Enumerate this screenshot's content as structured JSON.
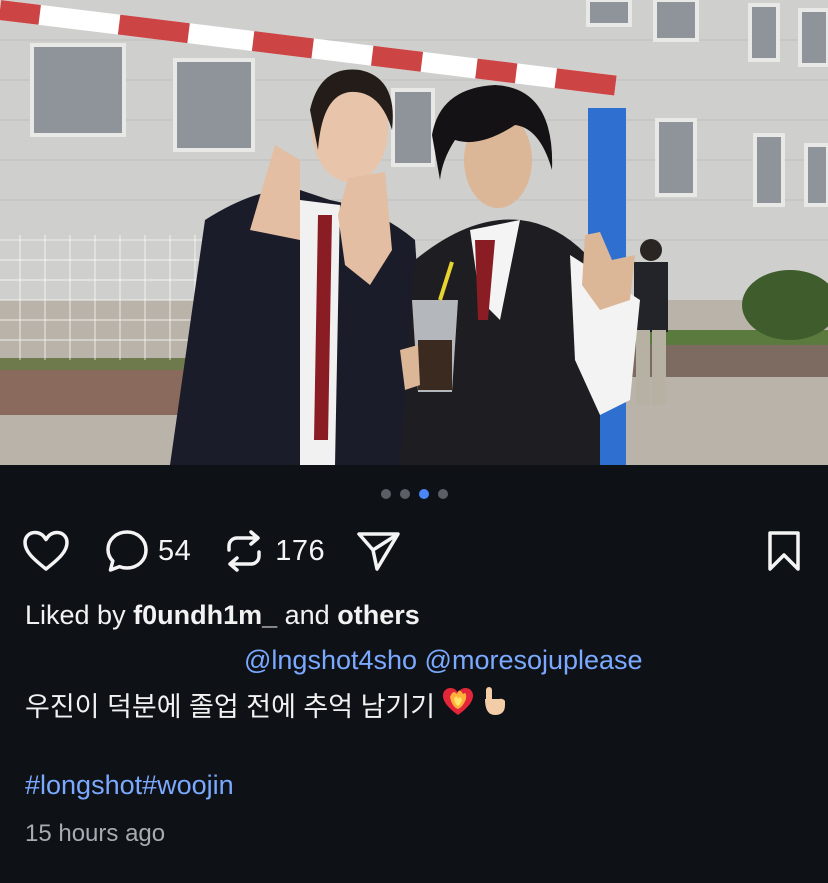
{
  "post": {
    "image": {
      "description": "photo"
    },
    "carousel": {
      "count": 4,
      "active_index": 2
    },
    "actions": {
      "like_icon": "heart-icon",
      "comment_icon": "comment-bubble-icon",
      "comment_count": "54",
      "repost_icon": "repost-icon",
      "repost_count": "176",
      "share_icon": "send-icon",
      "bookmark_icon": "bookmark-icon"
    },
    "liked_by": {
      "prefix": "Liked by",
      "user": "f0undh1m_",
      "joiner": "and",
      "others": "others"
    },
    "mentions": [
      "@lngshot4sho",
      "@moresojuplease"
    ],
    "caption": "우진이 덕분에 졸업 전에 추억 남기기",
    "caption_emojis": [
      "heart-on-fire-emoji",
      "raised-pinky-hand-emoji"
    ],
    "hashtags": [
      "#longshot",
      "#woojin"
    ],
    "timestamp": "15 hours ago"
  },
  "colors": {
    "background": "#0e1116",
    "text": "#f2f2f2",
    "link": "#7aa9ff",
    "muted": "#a8abb1",
    "dot_active": "#4a86f7",
    "dot_inactive": "#5a5f66"
  }
}
